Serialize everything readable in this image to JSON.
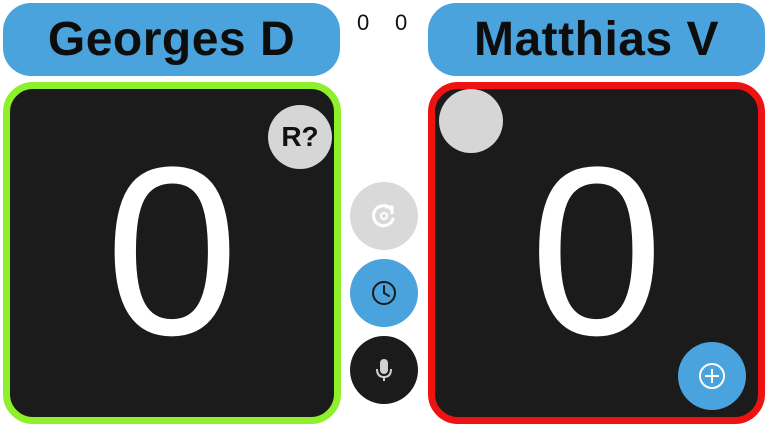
{
  "players": {
    "left": {
      "name": "Georges D",
      "games": "0",
      "score": "0",
      "badge": "R?"
    },
    "right": {
      "name": "Matthias V",
      "games": "0",
      "score": "0"
    }
  },
  "controls": {
    "reset_icon": "reset-icon",
    "timer_icon": "clock-icon",
    "mic_icon": "microphone-icon",
    "add_icon": "plus-circle-icon"
  },
  "colors": {
    "accent_blue": "#4aa3dc",
    "left_border": "#8ef02a",
    "right_border": "#ef1212",
    "panel_bg": "#1b1b1b",
    "grey_button": "#d9d9d9"
  }
}
